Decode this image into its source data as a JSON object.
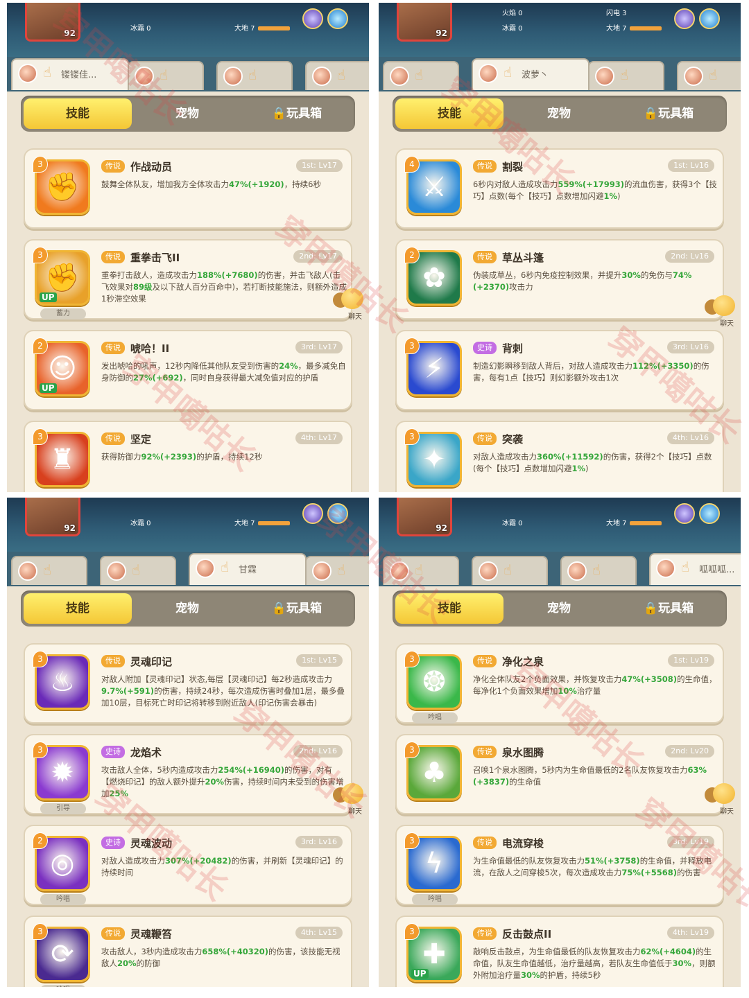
{
  "watermark": "穿甲噶咕长",
  "panels": [
    {
      "hud": {
        "level": "92",
        "stat1": "冰霜 0",
        "stat2": "大地 7"
      },
      "characters": [
        {
          "name": "镂镂佳...",
          "active": true
        },
        {
          "name": "",
          "active": false
        },
        {
          "name": "",
          "active": false
        },
        {
          "name": "",
          "active": false
        }
      ],
      "tabs": {
        "skills": "技能",
        "pets": "宠物",
        "toybox": "🔒玩具箱"
      },
      "chat_label": "聊天",
      "skills": [
        {
          "rank": "3",
          "rarity": "传说",
          "rarity_type": "leg",
          "name": "作战动员",
          "slot": "1st: Lv17",
          "desc": "鼓舞全体队友，增加我方全体攻击力47%(+1920)，持续6秒",
          "sub": "",
          "up": false,
          "icon": "fist-shadow-icon",
          "icon_bg": "#f07a1e"
        },
        {
          "rank": "3",
          "rarity": "传说",
          "rarity_type": "leg",
          "name": "重拳击飞II",
          "slot": "2nd: Lv17",
          "desc": "重拳打击敌人，造成攻击力188%(+7680)的伤害，并击飞敌人(击飞效果对89级及以下敌人百分百命中)，若打断技能施法，则额外造成1秒滞空效果",
          "sub": "蓄力",
          "up": true,
          "icon": "punch-icon",
          "icon_bg": "#e8a12a"
        },
        {
          "rank": "2",
          "rarity": "传说",
          "rarity_type": "leg",
          "name": "唬哈！II",
          "slot": "3rd: Lv17",
          "desc": "发出唬哈的吼声，12秒内降低其他队友受到伤害的24%，最多减免自身防御的27%(+692)，同时自身获得最大减免值对应的护盾",
          "sub": "",
          "up": true,
          "icon": "shout-icon",
          "icon_bg": "#e8622a"
        },
        {
          "rank": "3",
          "rarity": "传说",
          "rarity_type": "leg",
          "name": "坚定",
          "slot": "4th: Lv17",
          "desc": "获得防御力92%(+2393)的护盾，持续12秒",
          "sub": "",
          "up": false,
          "icon": "shield-icon",
          "icon_bg": "#d8401e"
        }
      ]
    },
    {
      "hud": {
        "level": "92",
        "stat1": "冰霜 0",
        "stat2": "大地 7",
        "stat3": "火焰 0",
        "stat4": "闪电 3"
      },
      "characters": [
        {
          "name": "",
          "active": false
        },
        {
          "name": "波萝丶",
          "active": true
        },
        {
          "name": "",
          "active": false
        },
        {
          "name": "",
          "active": false
        }
      ],
      "tabs": {
        "skills": "技能",
        "pets": "宠物",
        "toybox": "🔒玩具箱"
      },
      "chat_label": "聊天",
      "skills": [
        {
          "rank": "4",
          "rarity": "传说",
          "rarity_type": "leg",
          "name": "割裂",
          "slot": "1st: Lv16",
          "desc": "6秒内对敌人造成攻击力559%(+17993)的流血伤害，获得3个【技巧】点数(每个【技巧】点数增加闪避1%)",
          "sub": "",
          "up": false,
          "icon": "dagger-icon",
          "icon_bg": "#2a8ad8"
        },
        {
          "rank": "2",
          "rarity": "传说",
          "rarity_type": "leg",
          "name": "草丛斗篷",
          "slot": "2nd: Lv16",
          "desc": "伪装成草丛，6秒内免疫控制效果，并提升30%的免伤与74%(+2370)攻击力",
          "sub": "",
          "up": false,
          "icon": "bush-icon",
          "icon_bg": "#1f7a4a"
        },
        {
          "rank": "3",
          "rarity": "史诗",
          "rarity_type": "epic",
          "name": "背刺",
          "slot": "3rd: Lv16",
          "desc": "制造幻影瞬移到敌人背后，对敌人造成攻击力112%(+3350)的伤害，每有1点【技巧】则幻影额外攻击1次",
          "sub": "",
          "up": false,
          "icon": "backstab-icon",
          "icon_bg": "#2a4ad0"
        },
        {
          "rank": "3",
          "rarity": "传说",
          "rarity_type": "leg",
          "name": "突袭",
          "slot": "4th: Lv16",
          "desc": "对敌人造成攻击力360%(+11592)的伤害，获得2个【技巧】点数(每个【技巧】点数增加闪避1%)",
          "sub": "",
          "up": false,
          "icon": "slash-icon",
          "icon_bg": "#3aa6c8"
        }
      ]
    },
    {
      "hud": {
        "level": "92",
        "stat1": "冰霜 0",
        "stat2": "大地 7"
      },
      "characters": [
        {
          "name": "",
          "active": false
        },
        {
          "name": "",
          "active": false
        },
        {
          "name": "甘霖",
          "active": true
        },
        {
          "name": "",
          "active": false
        }
      ],
      "tabs": {
        "skills": "技能",
        "pets": "宠物",
        "toybox": "🔒玩具箱"
      },
      "chat_label": "聊天",
      "skills": [
        {
          "rank": "3",
          "rarity": "传说",
          "rarity_type": "leg",
          "name": "灵魂印记",
          "slot": "1st: Lv15",
          "desc": "对敌人附加【灵魂印记】状态,每层【灵魂印记】每2秒造成攻击力9.7%(+591)的伤害，持续24秒，每次造成伤害时叠加1层，最多叠加10层，目标死亡时印记将转移到附近敌人(印记伤害会暴击)",
          "sub": "",
          "up": false,
          "icon": "soul-flame-icon",
          "icon_bg": "#6a2ab8"
        },
        {
          "rank": "3",
          "rarity": "史诗",
          "rarity_type": "epic",
          "name": "龙焰术",
          "slot": "2nd: Lv16",
          "desc": "攻击敌人全体，5秒内造成攻击力254%(+16940)的伤害，对有【燃烧印记】的敌人额外提升20%伤害，持续时间内未受到的伤害增加25%",
          "sub": "引导",
          "up": false,
          "icon": "dragon-fire-icon",
          "icon_bg": "#8a3ad0"
        },
        {
          "rank": "2",
          "rarity": "史诗",
          "rarity_type": "epic",
          "name": "灵魂波动",
          "slot": "3rd: Lv16",
          "desc": "对敌人造成攻击力307%(+20482)的伤害，并刷新【灵魂印记】的持续时间",
          "sub": "吟唱",
          "up": false,
          "icon": "soul-wave-icon",
          "icon_bg": "#7a30c0"
        },
        {
          "rank": "3",
          "rarity": "传说",
          "rarity_type": "leg",
          "name": "灵魂鞭笞",
          "slot": "4th: Lv15",
          "desc": "攻击敌人，3秒内造成攻击力658%(+40320)的伤害，该技能无视敌人20%的防御",
          "sub": "吟唱",
          "up": false,
          "icon": "soul-whip-icon",
          "icon_bg": "#4a2a90"
        }
      ]
    },
    {
      "hud": {
        "level": "92",
        "stat1": "冰霜 0",
        "stat2": "大地 7"
      },
      "characters": [
        {
          "name": "",
          "active": false
        },
        {
          "name": "",
          "active": false
        },
        {
          "name": "",
          "active": false
        },
        {
          "name": "呱呱呱...",
          "active": true
        }
      ],
      "tabs": {
        "skills": "技能",
        "pets": "宠物",
        "toybox": "🔒玩具箱"
      },
      "chat_label": "聊天",
      "skills": [
        {
          "rank": "3",
          "rarity": "传说",
          "rarity_type": "leg",
          "name": "净化之泉",
          "slot": "1st: Lv19",
          "desc": "净化全体队友2个负面效果，并恢复攻击力47%(+3508)的生命值，每净化1个负面效果增加10%治疗量",
          "sub": "吟唱",
          "up": false,
          "icon": "spring-icon",
          "icon_bg": "#3ab84a"
        },
        {
          "rank": "3",
          "rarity": "传说",
          "rarity_type": "leg",
          "name": "泉水图腾",
          "slot": "2nd: Lv20",
          "desc": "召唤1个泉水图腾，5秒内为生命值最低的2名队友恢复攻击力63%(+3837)的生命值",
          "sub": "",
          "up": false,
          "icon": "totem-icon",
          "icon_bg": "#5aa83a"
        },
        {
          "rank": "3",
          "rarity": "传说",
          "rarity_type": "leg",
          "name": "电流穿梭",
          "slot": "3rd: Lv19",
          "desc": "为生命值最低的队友恢复攻击力51%(+3758)的生命值，并释放电流，在敌人之间穿梭5次，每次造成攻击力75%(+5568)的伤害",
          "sub": "吟唱",
          "up": false,
          "icon": "lightning-icon",
          "icon_bg": "#2a6ad0"
        },
        {
          "rank": "3",
          "rarity": "传说",
          "rarity_type": "leg",
          "name": "反击鼓点II",
          "slot": "4th: Lv19",
          "desc": "敲响反击鼓点，为生命值最低的队友恢复攻击力62%(+4604)的生命值，队友生命值越低，治疗量越高，若队友生命值低于30%，则额外附加治疗量30%的护盾，持续5秒",
          "sub": "",
          "up": true,
          "icon": "drum-icon",
          "icon_bg": "#3aa85a"
        }
      ]
    }
  ]
}
